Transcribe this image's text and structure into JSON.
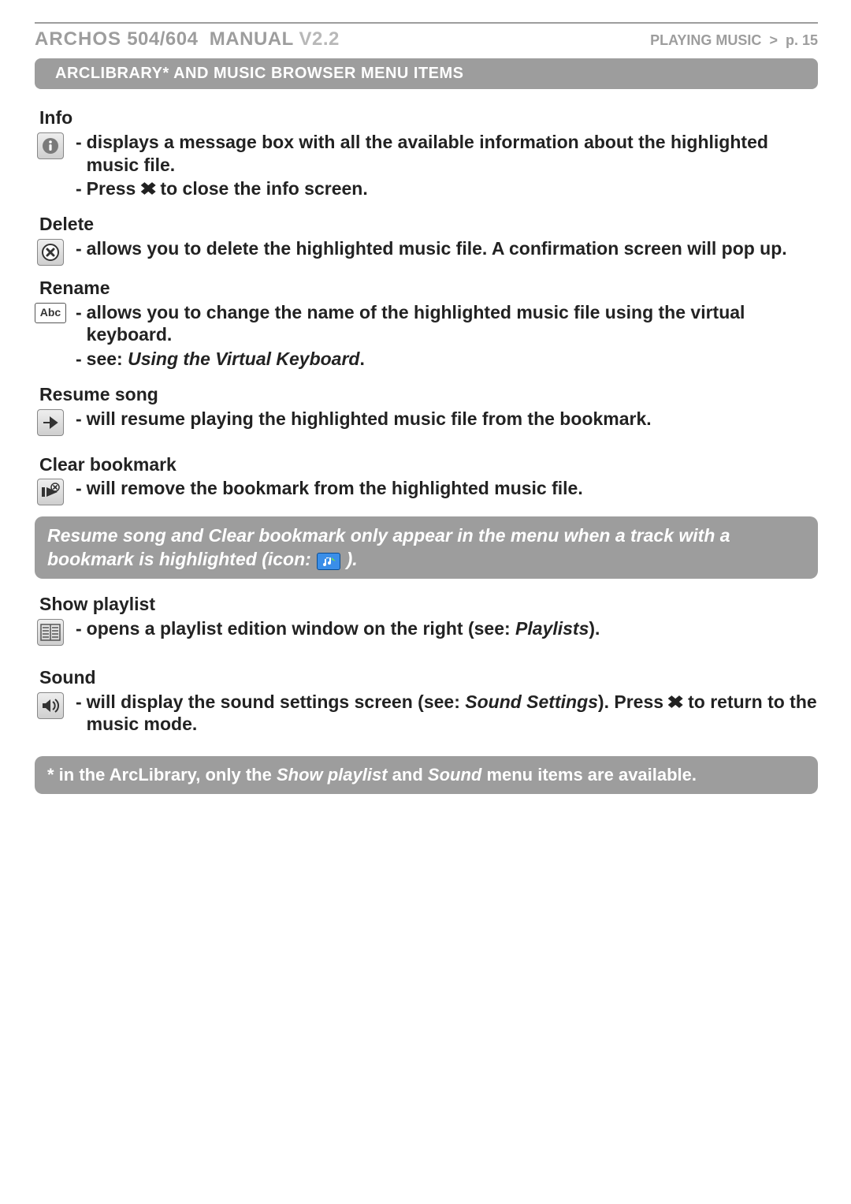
{
  "header": {
    "brand": "ARCHOS",
    "model": "504/604",
    "manual": "MANUAL",
    "version": "V2.2",
    "crumb_section": "PLAYING MUSIC",
    "crumb_sep": ">",
    "crumb_page": "p. 15"
  },
  "section_title": "ARCLIBRARY* AND MUSIC BROWSER MENU ITEMS",
  "items": {
    "info": {
      "title": "Info",
      "b1a": "displays a message box with all the available information about the highlight",
      "b1b": "ed music file.",
      "b2a": "Press ",
      "b2b": " to close the info screen."
    },
    "delete": {
      "title": "Delete",
      "b1": "allows you to delete the highlighted music file. A confirmation screen will pop up."
    },
    "rename": {
      "title": "Rename",
      "icon_label": "Abc",
      "b1": "allows you to change the name of the highlighted music file using the virtual keyboard.",
      "b2a": "see: ",
      "b2b": "Using the Virtual Keyboard",
      "b2c": "."
    },
    "resume": {
      "title": "Resume song",
      "b1": "will resume playing the highlighted music file from the bookmark."
    },
    "clear": {
      "title": "Clear bookmark",
      "b1": "will remove the bookmark from the highlighted music file."
    },
    "show": {
      "title": "Show playlist",
      "b1a": "opens a playlist edition window on the right (see: ",
      "b1b": "Playlists",
      "b1c": ")."
    },
    "sound": {
      "title": "Sound",
      "b1a": "will display the sound settings screen (see: ",
      "b1b": "Sound Settings",
      "b1c": "). Press ",
      "b1d": " to return to the music mode."
    }
  },
  "note1a": "Resume song and Clear bookmark only appear in the menu when a track with a bookmark is highlighted (icon: ",
  "note1b": " ).",
  "note2a": "* in the ArcLibrary, only the ",
  "note2b": "Show playlist",
  "note2c": " and ",
  "note2d": "Sound",
  "note2e": " menu items are available.",
  "glyphs": {
    "x": "✖"
  }
}
